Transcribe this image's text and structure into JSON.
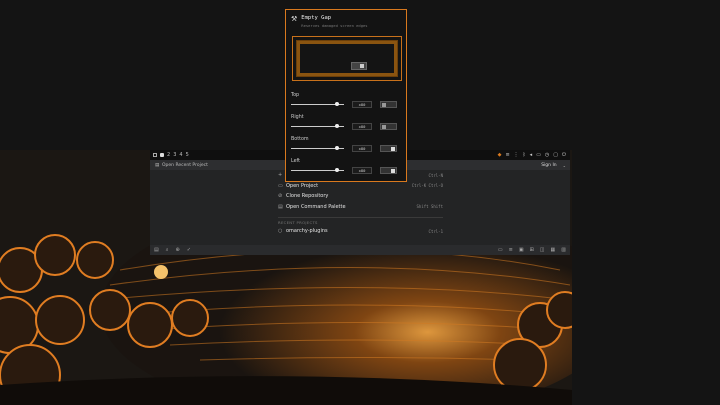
{
  "workspaces": [
    "1",
    "2",
    "3",
    "4",
    "5"
  ],
  "tray_icons": [
    "app-icon",
    "menu-icon",
    "network-icon",
    "bluetooth-icon",
    "volume-icon",
    "battery-icon",
    "clock-icon",
    "monitor-icon",
    "power-icon"
  ],
  "zed": {
    "title": "Open Recent Project",
    "signin": "Sign In",
    "actions": [
      {
        "icon": "+",
        "label": "",
        "kb": "Ctrl-N"
      },
      {
        "icon": "▭",
        "label": "Open Project",
        "kb": "Ctrl-K  Ctrl-O"
      },
      {
        "icon": "⊘",
        "label": "Clone Repository",
        "kb": ""
      },
      {
        "icon": "▤",
        "label": "Open Command Palette",
        "kb": "Shift  Shift"
      }
    ],
    "recent_label": "RECENT PROJECTS",
    "recent": [
      {
        "label": "omarchy-plugins",
        "kb": "Ctrl-1"
      }
    ]
  },
  "popup": {
    "title": "Empty Gap",
    "subtitle": "Reserves damaged screen edges",
    "controls": [
      {
        "name": "Top",
        "value": "x80",
        "fill": 0.9,
        "toggle": false
      },
      {
        "name": "Right",
        "value": "x80",
        "fill": 0.9,
        "toggle": false
      },
      {
        "name": "Bottom",
        "value": "x80",
        "fill": 0.9,
        "toggle": true
      },
      {
        "name": "Left",
        "value": "x80",
        "fill": 0.9,
        "toggle": true
      }
    ]
  },
  "colors": {
    "accent": "#d9791e",
    "bg": "#141414",
    "panel": "#232425"
  }
}
